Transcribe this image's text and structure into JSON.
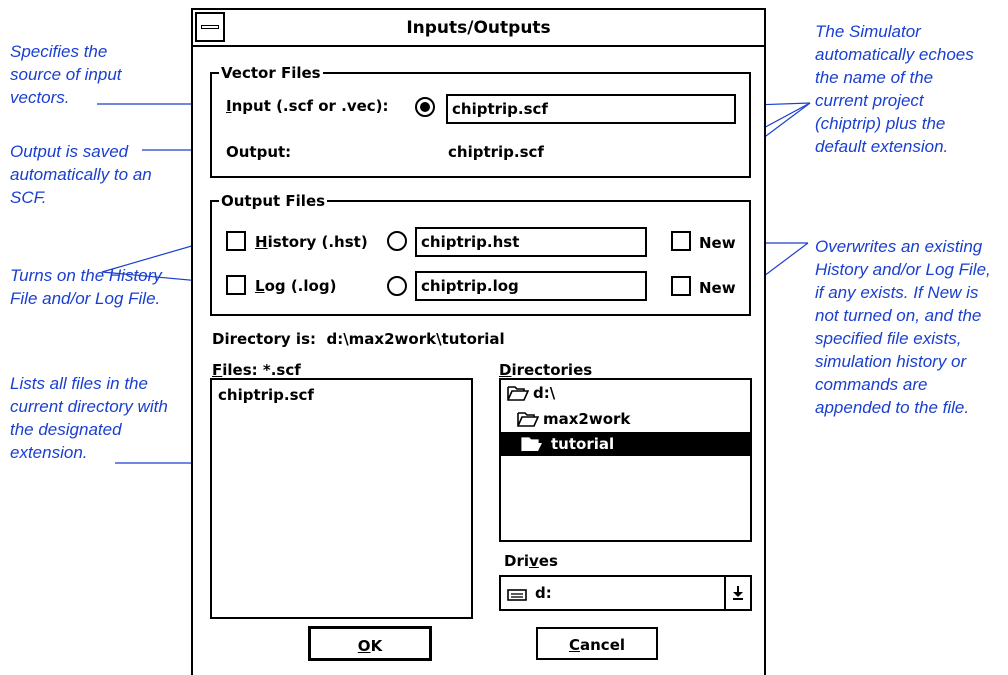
{
  "notes": {
    "input_source": "Specifies the source of input vectors.",
    "output_saved": "Output is saved automatically to an SCF.",
    "turns_on": "Turns on the History File and/or Log File.",
    "lists_files": "Lists all files in the current directory with the designated extension.",
    "echoes": "The Simulator automatically echoes the name of the current project (chiptrip) plus the default extension.",
    "overwrites": "Overwrites an existing History and/or Log File, if any exists. If New is not turned on, and the specified file exists, simulation history or commands are appended to the file."
  },
  "dialog": {
    "title": "Inputs/Outputs",
    "vector_files": {
      "group_label": "Vector Files",
      "input_label_underlined": "I",
      "input_label_rest": "nput (.scf or .vec):",
      "input_value": "chiptrip.scf",
      "output_label": "Output:",
      "output_value": "chiptrip.scf"
    },
    "output_files": {
      "group_label": "Output Files",
      "history_label_underlined": "H",
      "history_label_rest": "istory (.hst)",
      "history_value": "chiptrip.hst",
      "log_label_underlined": "L",
      "log_label_rest": "og (.log)",
      "log_value": "chiptrip.log",
      "new_label": "New"
    },
    "directory_prefix": "Directory is:",
    "directory_path": "d:\\max2work\\tutorial",
    "files_label_underlined": "F",
    "files_label_rest": "iles: *.scf",
    "files": [
      "chiptrip.scf"
    ],
    "directories_label_underlined": "D",
    "directories_label_rest": "irectories",
    "directories": [
      "d:\\",
      "max2work",
      "tutorial"
    ],
    "drives_label_pre": "Dri",
    "drives_label_underlined": "v",
    "drives_label_post": "es",
    "drive_value": "d:",
    "ok_underlined": "O",
    "ok_rest": "K",
    "cancel_underlined": "C",
    "cancel_rest": "ancel"
  }
}
